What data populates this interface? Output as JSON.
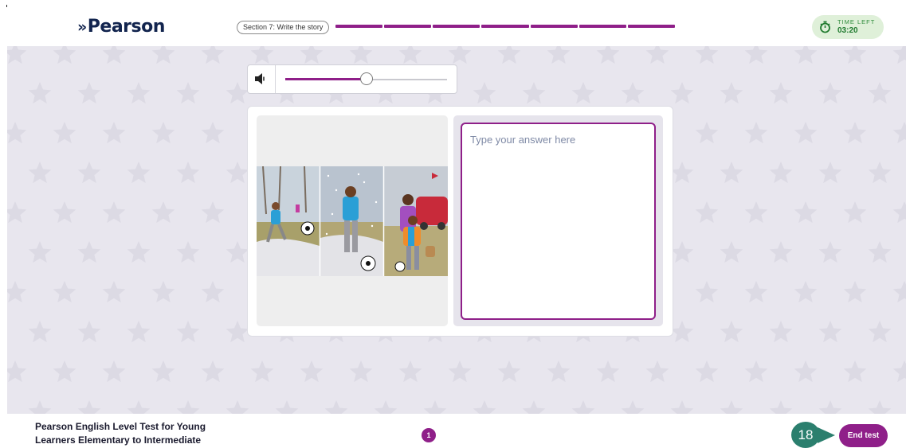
{
  "header": {
    "logo_text": "Pearson",
    "section_label": "Section 7: Write the story",
    "progress_segments": 7,
    "timer": {
      "label": "TIME LEFT",
      "value": "03:20",
      "icon": "stopwatch-icon"
    }
  },
  "audio": {
    "volume_icon": "speaker-icon",
    "volume_level": 0.5
  },
  "task": {
    "image_icon": "story-picture-strip",
    "answer_placeholder": "Type your answer here",
    "answer_value": ""
  },
  "footer": {
    "test_title": "Pearson English Level Test for Young Learners Elementary to Intermediate",
    "page_number": "1",
    "callout_number": "18",
    "end_button_label": "End test"
  },
  "colors": {
    "accent": "#8f1f89",
    "background": "#e8e6ee",
    "timer_bg": "#dff0d9",
    "timer_text": "#1f7a2e",
    "callout": "#2b7f6e",
    "logo": "#12244e"
  }
}
